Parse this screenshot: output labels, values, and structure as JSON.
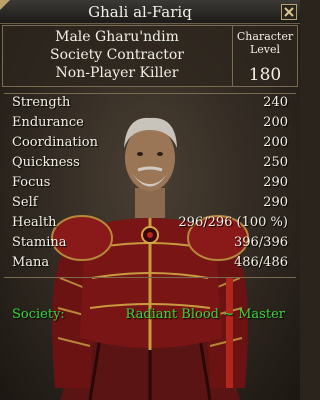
{
  "window": {
    "title": "Ghali al-Fariq"
  },
  "character": {
    "info_lines": [
      "Male Gharu'ndim",
      "Society Contractor",
      "Non-Player Killer"
    ],
    "level_label_1": "Character",
    "level_label_2": "Level",
    "level": "180"
  },
  "stats": [
    {
      "name": "Strength",
      "value": "240"
    },
    {
      "name": "Endurance",
      "value": "200"
    },
    {
      "name": "Coordination",
      "value": "200"
    },
    {
      "name": "Quickness",
      "value": "250"
    },
    {
      "name": "Focus",
      "value": "290"
    },
    {
      "name": "Self",
      "value": "290"
    }
  ],
  "vitals": [
    {
      "name": "Health",
      "value": "296/296 (100 %)"
    },
    {
      "name": "Stamina",
      "value": "396/396"
    },
    {
      "name": "Mana",
      "value": "486/486"
    }
  ],
  "society": {
    "label": "Society:",
    "value": "Radiant Blood ~ Master"
  },
  "colors": {
    "text": "#f5f1e6",
    "society": "#36d93a",
    "border": "#7a6a4e"
  },
  "icons": {
    "close": "close-icon"
  }
}
